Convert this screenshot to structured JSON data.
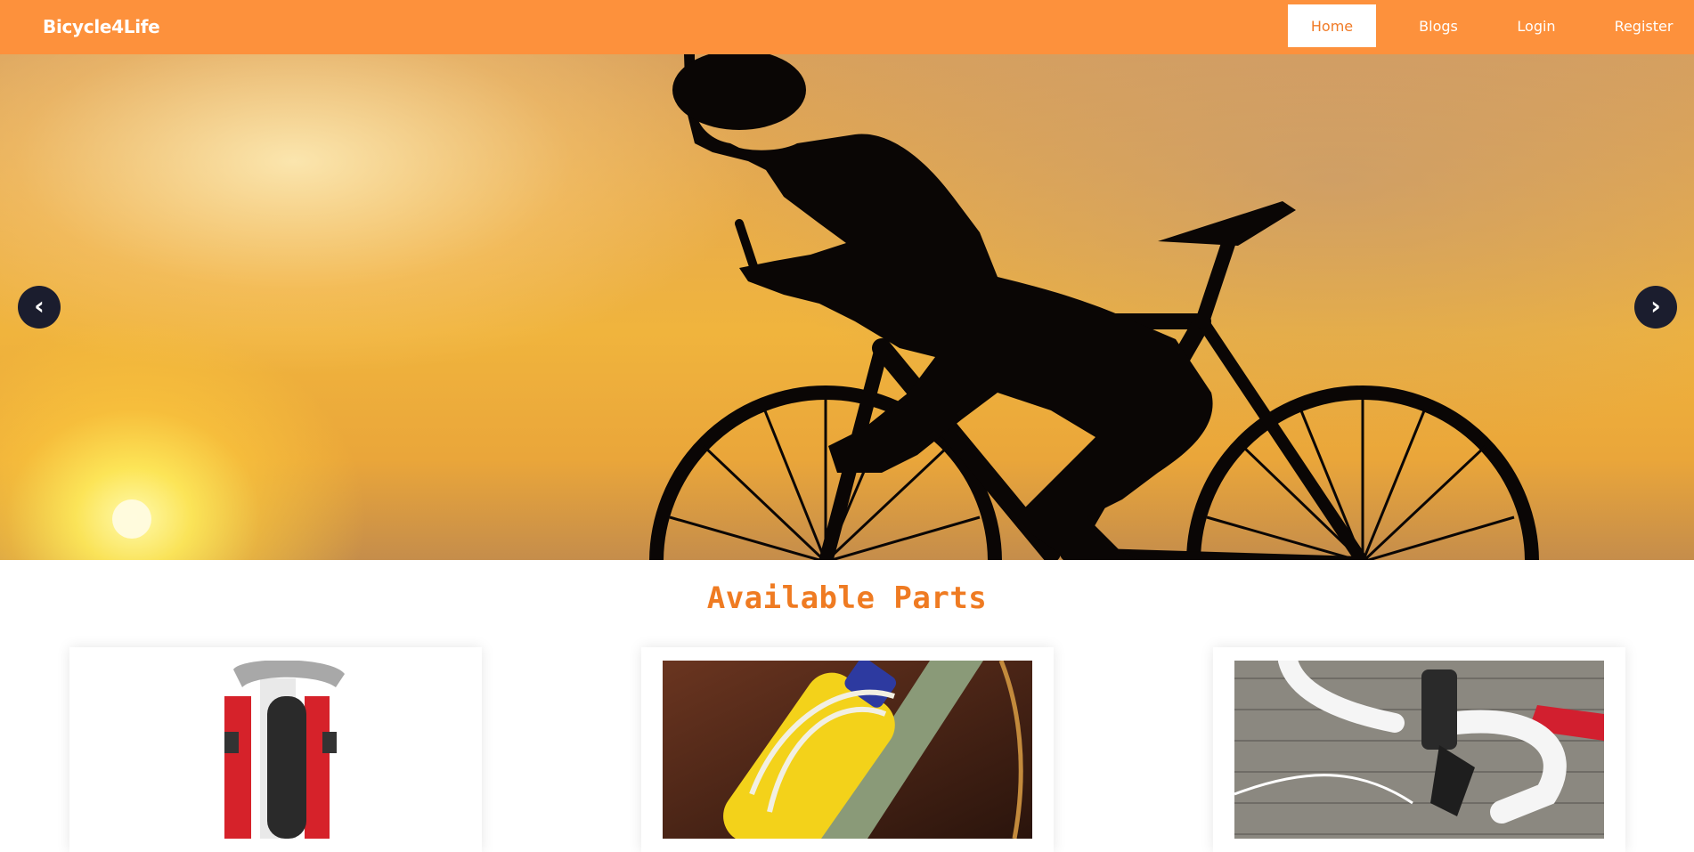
{
  "navbar": {
    "brand": "Bicycle4Life",
    "links": [
      {
        "label": "Home",
        "active": true
      },
      {
        "label": "Blogs",
        "active": false
      },
      {
        "label": "Login",
        "active": false
      },
      {
        "label": "Register",
        "active": false
      }
    ]
  },
  "hero": {
    "prev_icon": "‹",
    "next_icon": "›"
  },
  "parts_section": {
    "title": "Available Parts",
    "cards": [
      {
        "image": "bicycle-brake-wheel-photo"
      },
      {
        "image": "yellow-water-bottle-photo"
      },
      {
        "image": "handlebar-tape-photo"
      }
    ]
  },
  "colors": {
    "navbar": "#fd913c",
    "accent": "#ef7b22",
    "carousel_button": "#1b1d2e"
  }
}
